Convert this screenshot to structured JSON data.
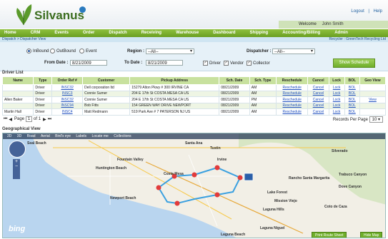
{
  "brand": {
    "name": "Silvanus"
  },
  "top_links": {
    "logout": "Logout",
    "sep": "|",
    "help": "Help"
  },
  "welcome": {
    "label": "Welcome",
    "user": "John Smith"
  },
  "nav": [
    "Home",
    "CRM",
    "Events",
    "Order",
    "Dispatch",
    "Receiving",
    "Warehouse",
    "Dashboard",
    "Shipping",
    "Accounting/Billing",
    "Admin"
  ],
  "breadcrumb": {
    "path": "Dispatch > Dispatcher View",
    "recycler": "Recycler : GreenTech Recycling Ltd"
  },
  "filters": {
    "radio_inbound": "InBound",
    "radio_outbound": "OutBound",
    "radio_event": "Event",
    "region_label": "Region :",
    "region_value": "--All--",
    "dispatcher_label": "Dispatcher :",
    "dispatcher_value": "--All--",
    "from_label": "From Date :",
    "from_value": "8/21/2009",
    "to_label": "To Date :",
    "to_value": "8/21/2009",
    "cb_driver": "Driver",
    "cb_vendor": "Vendor",
    "cb_collector": "Collector",
    "show_button": "Show Schedule"
  },
  "driver_list": {
    "title": "Driver List",
    "columns": [
      "Name",
      "Type",
      "Order Ref #",
      "Customer",
      "Pickup Address",
      "Sch. Date",
      "Sch. Type",
      "Reschedule",
      "Cancel",
      "Lock",
      "BOL",
      "Geo View"
    ],
    "rows": [
      {
        "name": "",
        "type": "Driver",
        "order": "INSC32",
        "customer": "Dell corporation ltd",
        "address": "15279 Alton Pkwy # 300 IRVINE CA",
        "date": "08/21/2009",
        "stype": "AM",
        "reschedule": "Reschedule",
        "cancel": "Cancel",
        "lock": "Lock",
        "bol": "BOL",
        "geo": ""
      },
      {
        "name": "",
        "type": "Driver",
        "order": "INSC3",
        "customer": "Connie Sumer",
        "address": "204 E 17th St COSTA MESA CA US",
        "date": "08/21/2009",
        "stype": "AM",
        "reschedule": "Reschedule",
        "cancel": "Cancel",
        "lock": "Lock",
        "bol": "BOL",
        "geo": ""
      },
      {
        "name": "Allen Baker",
        "type": "Driver",
        "order": "INSC32",
        "customer": "Connie Sumer",
        "address": "204 E 17th St COSTA MESA CA US",
        "date": "08/21/2009",
        "stype": "PM",
        "reschedule": "Reschedule",
        "cancel": "Cancel",
        "lock": "Lock",
        "bol": "BOL",
        "geo": "View"
      },
      {
        "name": "",
        "type": "Driver",
        "order": "INSC94",
        "customer": "Bob Fitts",
        "address": "154 GREEN WAY DRIVE NEWPORT",
        "date": "08/21/2009",
        "stype": "AM",
        "reschedule": "Reschedule",
        "cancel": "Cancel",
        "lock": "Lock",
        "bol": "BOL",
        "geo": ""
      },
      {
        "name": "Martin Hall",
        "type": "Driver",
        "order": "INSC4",
        "customer": "Matt Redmann",
        "address": "519 Park Ave # 7 PATERSON NJ US",
        "date": "08/21/2009",
        "stype": "AM",
        "reschedule": "Reschedule",
        "cancel": "Cancel",
        "lock": "Lock",
        "bol": "BOL",
        "geo": ""
      }
    ]
  },
  "pager": {
    "page_label": "Page",
    "page_value": "1",
    "of_label": "of 1",
    "records_label": "Records Per Page",
    "records_value": "10"
  },
  "geo": {
    "title": "Geographical View",
    "toolbar": [
      "2D",
      "3D",
      "Road",
      "Aerial",
      "Bird's eye",
      "Labels",
      "Locate me",
      "Collections"
    ],
    "labels": [
      "Seal Beach",
      "Santa Ana",
      "Tustin",
      "Fountain Valley",
      "Huntington Beach",
      "Costa Mesa",
      "Irvine",
      "Newport Beach",
      "Lake Forest",
      "Mission Viejo",
      "Laguna Hills",
      "Laguna Niguel",
      "Laguna Beach",
      "Rancho Santa Margarita",
      "Silverado",
      "Dove Canyon",
      "Trabuco Canyon",
      "Coto de Caza"
    ],
    "print_button": "Print Route Sheet",
    "hide_button": "Hide Map",
    "bing": "bing"
  }
}
